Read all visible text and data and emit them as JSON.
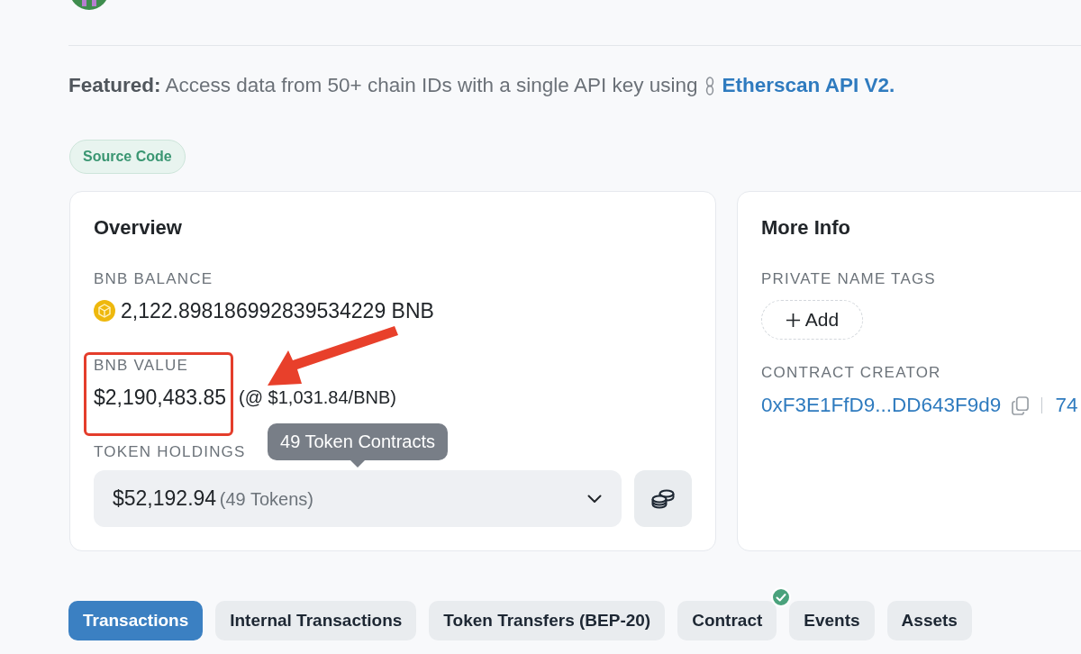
{
  "featured": {
    "text": "**Featured:** Access data from 50+ chain IDs with a single API key using",
    "link": "Etherscan API V2."
  },
  "badge": "Source Code",
  "overview": {
    "title": "Overview",
    "fields": [
      {
        "kind": "balance",
        "label": "BNB BALANCE",
        "value": "2,122.898186992839534229 BNB"
      },
      {
        "kind": "price",
        "label": "BNB VALUE",
        "value": "$2,190,483.85",
        "rate": "(@ $1,031.84/BNB)"
      },
      {
        "kind": "holdings",
        "label": "TOKEN HOLDINGS",
        "value": "$52,192.94",
        "count": "(49 Tokens)",
        "tooltip": "49 Token Contracts"
      }
    ],
    "annotations": {
      "highlight_box": true,
      "arrow": true
    }
  },
  "more_info": {
    "title": "More Info",
    "fields": [
      {
        "kind": "tags",
        "label": "PRIVATE NAME TAGS",
        "button": "Add"
      },
      {
        "kind": "creator",
        "label": "CONTRACT CREATOR",
        "address": "0xF3E1FfD9...DD643F9d9",
        "column_2": "74"
      }
    ]
  },
  "tabs": [
    {
      "label": "Transactions",
      "selected": true,
      "verified": false
    },
    {
      "label": "Internal Transactions",
      "selected": false,
      "verified": false
    },
    {
      "label": "Token Transfers (BEP-20)",
      "selected": false,
      "verified": false
    },
    {
      "label": "Contract",
      "selected": false,
      "verified": true
    },
    {
      "label": "Events",
      "selected": false,
      "verified": false
    },
    {
      "label": "Assets",
      "selected": false,
      "verified": false
    }
  ]
}
